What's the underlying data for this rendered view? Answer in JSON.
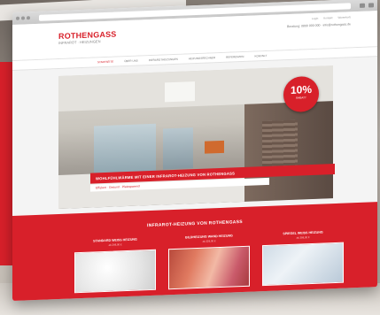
{
  "site": {
    "logo_main": "ROTHENGASS",
    "logo_sub": "INFRAROT · HEIZUNGEN",
    "contact": "Beratung: 0800 000 000 · info@rothengass.de",
    "toplinks": [
      "Login",
      "Kontakt",
      "Warenkorb"
    ]
  },
  "nav": {
    "items": [
      "Startseite",
      "Über uns",
      "Infrarotheizungen",
      "Heizungsrechner",
      "Referenzen",
      "Kontakt"
    ]
  },
  "hero": {
    "badge_value": "10%",
    "badge_label": "RABATT",
    "banner": "Wohlfühlwärme mit einer Infrarot-Heizung von Rothengass",
    "banner_sub": "Effizient · Gesund · Platzsparend"
  },
  "section": {
    "title": "INFRAROT-HEIZUNG VON ROTHENGASS",
    "products": [
      {
        "title": "Standard Weiß Heizung",
        "sub": "ab 249,00 €"
      },
      {
        "title": "Bildheizung Wand Heizung",
        "sub": "ab 329,00 €"
      },
      {
        "title": "Spiegel Weiß Heizung",
        "sub": "ab 399,00 €"
      }
    ]
  },
  "colors": {
    "brand_red": "#d8202a"
  },
  "icons": [
    "window-dot-icon",
    "menu-icon"
  ]
}
